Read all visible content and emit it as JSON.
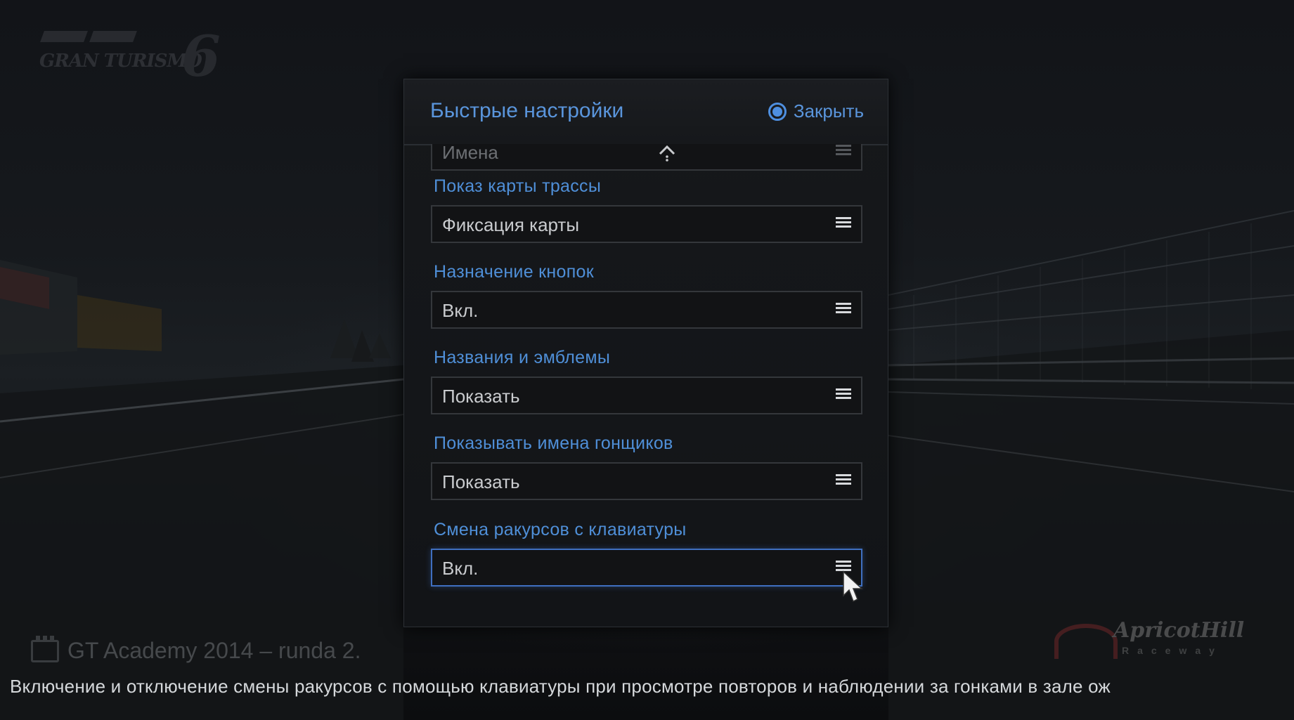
{
  "game_logo": {
    "text": "GRAN TURISMO",
    "number": "6"
  },
  "event": {
    "title": "GT Academy 2014 – runda 2."
  },
  "track_logo": {
    "name": "ApricotHill",
    "subtitle": "Raceway"
  },
  "dialog": {
    "title": "Быстрые настройки",
    "close_label": "Закрыть",
    "settings": [
      {
        "label": "",
        "value": "Имена",
        "state": "scrolled-partial"
      },
      {
        "label": "Показ карты трассы",
        "value": "Фиксация карты"
      },
      {
        "label": "Назначение кнопок",
        "value": "Вкл."
      },
      {
        "label": "Названия и эмблемы",
        "value": "Показать"
      },
      {
        "label": "Показывать имена гонщиков",
        "value": "Показать"
      },
      {
        "label": "Смена ракурсов с клавиатуры",
        "value": "Вкл.",
        "state": "focused"
      }
    ]
  },
  "hint": "Включение и отключение смены ракурсов с помощью клавиатуры при просмотре повторов и наблюдении за гонками в зале ож",
  "icons": {
    "close": "circle-button-icon",
    "dropdown": "menu-icon",
    "scroll": "scroll-up-icon",
    "pointer": "cursor-icon"
  },
  "colors": {
    "accent": "#5a95dc",
    "focus_border": "#3f6fc0",
    "value_text": "#c9cbce",
    "hint_text": "#d5d8db"
  }
}
